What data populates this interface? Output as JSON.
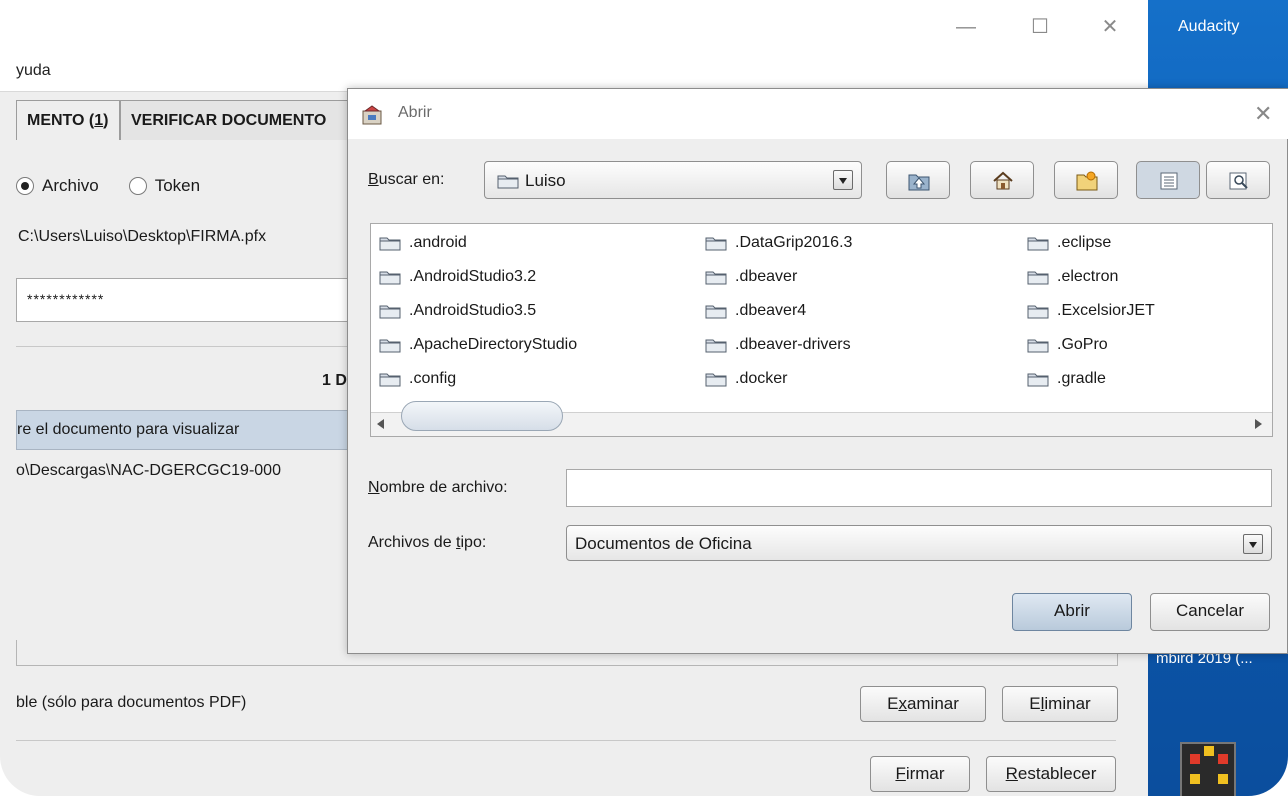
{
  "main_window": {
    "window_controls": {
      "minimize": "—",
      "maximize": "☐",
      "close": "✕"
    },
    "menu": {
      "item": "yuda"
    },
    "tabs": [
      {
        "label_pre": "MENTO (",
        "label_mnemonic": "1",
        "label_post": ")"
      },
      {
        "label": "VERIFICAR DOCUMENTO"
      }
    ],
    "source": {
      "option_file": "Archivo",
      "option_token": "Token"
    },
    "certificate_path": "C:\\Users\\Luiso\\Desktop\\FIRMA.pfx",
    "password_mask": "************",
    "pages_label": "1 D",
    "select_doc_label": "re el documento para visualizar",
    "document_path": "o\\Descargas\\NAC-DGERCGC19-000",
    "pdf_label": "ble (sólo para documentos PDF)",
    "buttons": {
      "examinar": {
        "pre": "E",
        "mn": "x",
        "post": "aminar"
      },
      "eliminar": {
        "pre": "E",
        "mn": "l",
        "post": "iminar"
      },
      "firmar": {
        "pre": "",
        "mn": "F",
        "post": "irmar"
      },
      "restablecer": {
        "pre": "",
        "mn": "R",
        "post": "establecer"
      }
    }
  },
  "desktop": {
    "top_label": "Audacity",
    "bottom_label": "mbird 2019 (..."
  },
  "dialog": {
    "title": "Abrir",
    "look_in": {
      "label_mn": "B",
      "label_rest": "uscar en:",
      "value": "Luiso"
    },
    "files": [
      ".android",
      ".AndroidStudio3.2",
      ".AndroidStudio3.5",
      ".ApacheDirectoryStudio",
      ".config",
      ".DataGrip2016.3",
      ".dbeaver",
      ".dbeaver4",
      ".dbeaver-drivers",
      ".docker",
      ".eclipse",
      ".electron",
      ".ExcelsiorJET",
      ".GoPro",
      ".gradle"
    ],
    "file_name": {
      "label_mn": "N",
      "label_rest": "ombre de archivo:",
      "value": ""
    },
    "file_type": {
      "label_pre": "Archivos de ",
      "label_mn": "t",
      "label_post": "ipo:",
      "value": "Documentos de Oficina"
    },
    "open_label": "Abrir",
    "cancel_label": "Cancelar"
  },
  "colors": {
    "desktop_blue": "#0a59b1",
    "selection": "#c9d6e4",
    "window_bg": "#eeeeee"
  }
}
